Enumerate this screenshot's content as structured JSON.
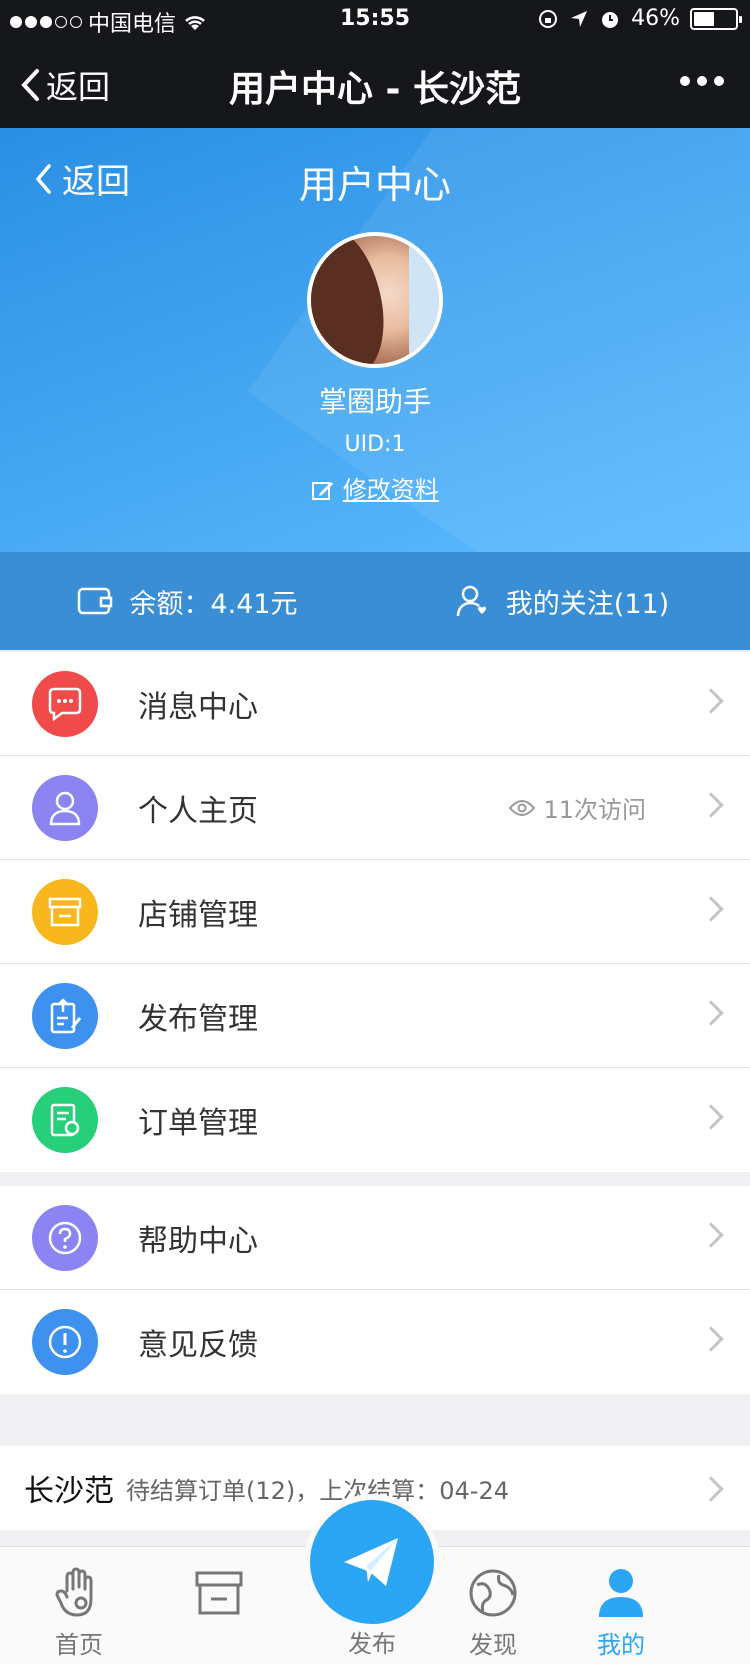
{
  "statusbar": {
    "carrier": "中国电信",
    "time": "15:55",
    "battery": "46%"
  },
  "wx_nav": {
    "back": "返回",
    "title": "用户中心 - 长沙范"
  },
  "hero": {
    "back": "返回",
    "title": "用户中心",
    "name": "掌圈助手",
    "uid": "UID:1",
    "edit": "修改资料"
  },
  "stats": {
    "balance": "余额：4.41元",
    "follow": "我的关注(11)"
  },
  "menu1": [
    {
      "label": "消息中心",
      "color": "#f04a4a",
      "icon": "message-icon"
    },
    {
      "label": "个人主页",
      "color": "#8c84f3",
      "icon": "user-icon",
      "extra": "11次访问"
    },
    {
      "label": "店铺管理",
      "color": "#f8b71d",
      "icon": "shop-icon"
    },
    {
      "label": "发布管理",
      "color": "#3e91ef",
      "icon": "publish-manage-icon"
    },
    {
      "label": "订单管理",
      "color": "#27cf7b",
      "icon": "order-icon"
    }
  ],
  "menu2": [
    {
      "label": "帮助中心",
      "color": "#8c84f3",
      "icon": "help-icon"
    },
    {
      "label": "意见反馈",
      "color": "#3e91ef",
      "icon": "feedback-icon"
    }
  ],
  "settle": {
    "city": "长沙范",
    "info": "待结算订单(12)，上次结算：04-24"
  },
  "tabbar": {
    "home": "首页",
    "publish": "发布",
    "discover": "发现",
    "mine": "我的"
  },
  "colors": {
    "accent": "#2aa6f4",
    "header": "#3a8ed6"
  }
}
